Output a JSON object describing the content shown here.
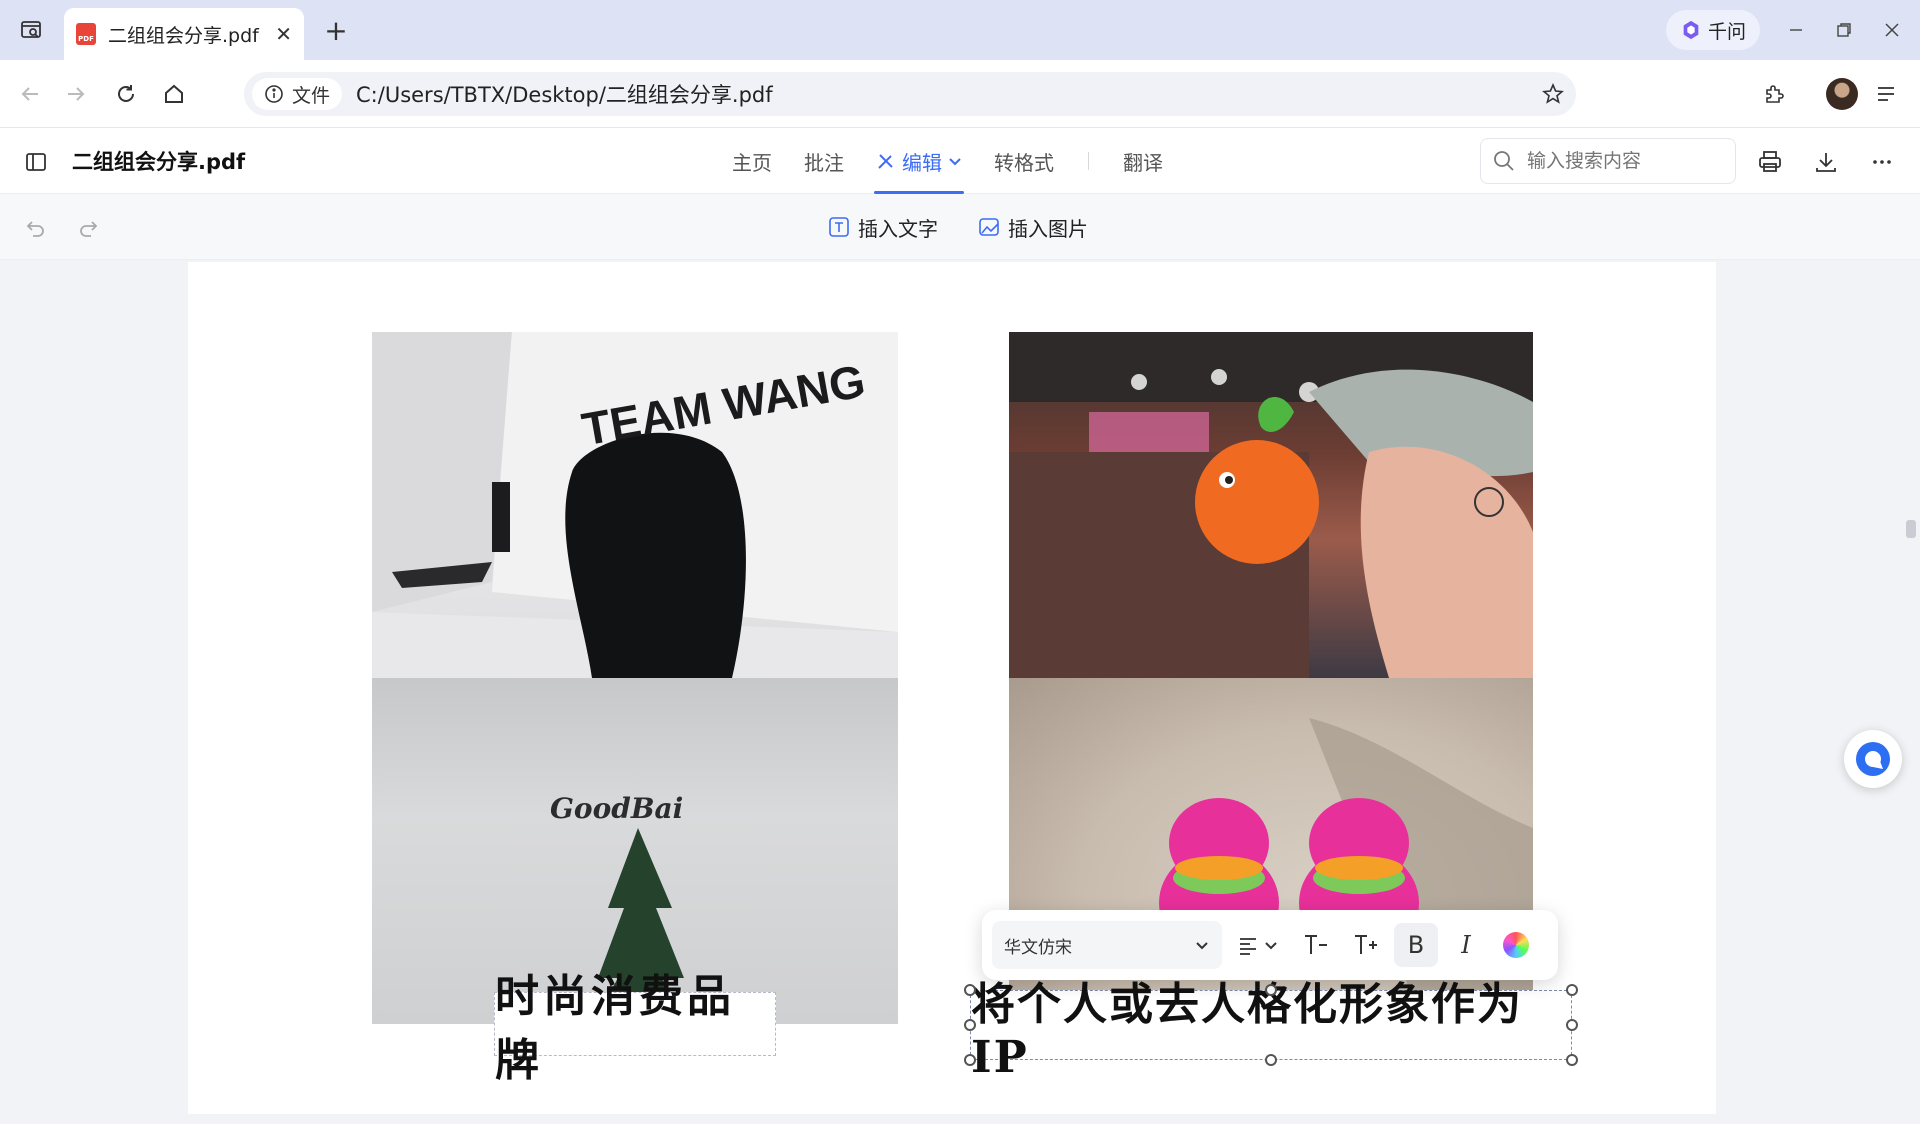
{
  "browser": {
    "tab_title": "二组组会分享.pdf",
    "tab_close": "✕",
    "new_tab": "+",
    "qianwen_label": "千问",
    "address": {
      "chip_label": "文件",
      "url": "C:/Users/TBTX/Desktop/二组组会分享.pdf"
    }
  },
  "viewer": {
    "doc_title": "二组组会分享.pdf",
    "menu": [
      {
        "label": "主页"
      },
      {
        "label": "批注"
      },
      {
        "label": "编辑",
        "active": true
      },
      {
        "label": "转格式"
      },
      {
        "label": "翻译"
      }
    ],
    "search_placeholder": "输入搜索内容"
  },
  "edit_toolbar": {
    "insert_text": "插入文字",
    "insert_image": "插入图片"
  },
  "document": {
    "photos": [
      {
        "overlay_text": "TEAM WANG"
      },
      {
        "overlay_text": "GoodBai"
      },
      {
        "overlay_text": ""
      },
      {
        "overlay_text": ""
      }
    ],
    "text_box_1": "时尚消费品牌",
    "text_box_2": "将个人或去人格化形象作为IP"
  },
  "text_format_bar": {
    "font_name": "华文仿宋",
    "bold_label": "B",
    "italic_label": "I"
  },
  "colors": {
    "accent": "#3d6cf5",
    "tabbar_bg": "#dde3f4",
    "pdf_icon": "#e8443a"
  }
}
